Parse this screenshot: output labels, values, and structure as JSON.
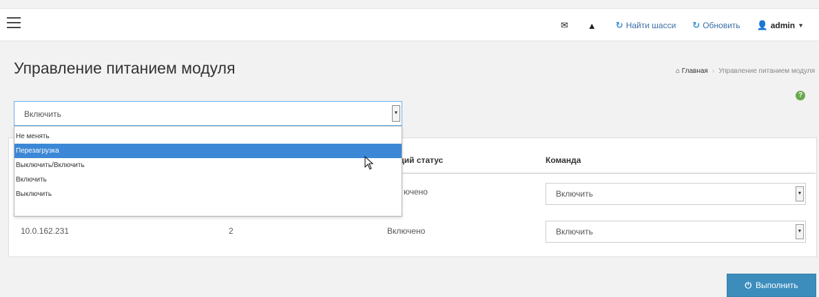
{
  "topbar": {
    "mail_icon": "envelope-icon",
    "alert_icon": "warning-icon",
    "find_chassis": "Найти шасси",
    "refresh": "Обновить",
    "user": "admin"
  },
  "page": {
    "title": "Управление питанием модуля",
    "breadcrumb_home": "Главная",
    "breadcrumb_current": "Управление питанием модуля"
  },
  "main_select": {
    "value": "Включить",
    "options": [
      "Не менять",
      "Перезагрузка",
      "Выключить/Включить",
      "Включить",
      "Выключить"
    ],
    "highlighted": "Перезагрузка"
  },
  "table": {
    "columns": [
      "ущий статус",
      "Команда"
    ],
    "rows": [
      {
        "status": "ючено",
        "command": "Включить"
      },
      {
        "ip": "10.0.162.231",
        "slot": "2",
        "status": "Включено",
        "command": "Включить"
      }
    ]
  },
  "actions": {
    "execute": "Выполнить"
  },
  "colors": {
    "accent": "#3c8dbc",
    "highlight": "#3c88d6",
    "help": "#6aa84f"
  }
}
